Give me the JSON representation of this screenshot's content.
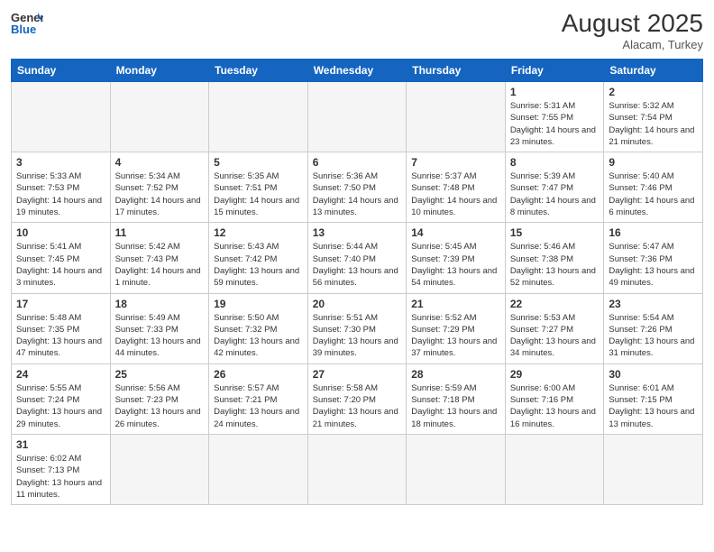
{
  "header": {
    "logo_general": "General",
    "logo_blue": "Blue",
    "month_year": "August 2025",
    "location": "Alacam, Turkey"
  },
  "weekdays": [
    "Sunday",
    "Monday",
    "Tuesday",
    "Wednesday",
    "Thursday",
    "Friday",
    "Saturday"
  ],
  "weeks": [
    [
      {
        "day": "",
        "info": ""
      },
      {
        "day": "",
        "info": ""
      },
      {
        "day": "",
        "info": ""
      },
      {
        "day": "",
        "info": ""
      },
      {
        "day": "",
        "info": ""
      },
      {
        "day": "1",
        "info": "Sunrise: 5:31 AM\nSunset: 7:55 PM\nDaylight: 14 hours\nand 23 minutes."
      },
      {
        "day": "2",
        "info": "Sunrise: 5:32 AM\nSunset: 7:54 PM\nDaylight: 14 hours\nand 21 minutes."
      }
    ],
    [
      {
        "day": "3",
        "info": "Sunrise: 5:33 AM\nSunset: 7:53 PM\nDaylight: 14 hours\nand 19 minutes."
      },
      {
        "day": "4",
        "info": "Sunrise: 5:34 AM\nSunset: 7:52 PM\nDaylight: 14 hours\nand 17 minutes."
      },
      {
        "day": "5",
        "info": "Sunrise: 5:35 AM\nSunset: 7:51 PM\nDaylight: 14 hours\nand 15 minutes."
      },
      {
        "day": "6",
        "info": "Sunrise: 5:36 AM\nSunset: 7:50 PM\nDaylight: 14 hours\nand 13 minutes."
      },
      {
        "day": "7",
        "info": "Sunrise: 5:37 AM\nSunset: 7:48 PM\nDaylight: 14 hours\nand 10 minutes."
      },
      {
        "day": "8",
        "info": "Sunrise: 5:39 AM\nSunset: 7:47 PM\nDaylight: 14 hours\nand 8 minutes."
      },
      {
        "day": "9",
        "info": "Sunrise: 5:40 AM\nSunset: 7:46 PM\nDaylight: 14 hours\nand 6 minutes."
      }
    ],
    [
      {
        "day": "10",
        "info": "Sunrise: 5:41 AM\nSunset: 7:45 PM\nDaylight: 14 hours\nand 3 minutes."
      },
      {
        "day": "11",
        "info": "Sunrise: 5:42 AM\nSunset: 7:43 PM\nDaylight: 14 hours\nand 1 minute."
      },
      {
        "day": "12",
        "info": "Sunrise: 5:43 AM\nSunset: 7:42 PM\nDaylight: 13 hours\nand 59 minutes."
      },
      {
        "day": "13",
        "info": "Sunrise: 5:44 AM\nSunset: 7:40 PM\nDaylight: 13 hours\nand 56 minutes."
      },
      {
        "day": "14",
        "info": "Sunrise: 5:45 AM\nSunset: 7:39 PM\nDaylight: 13 hours\nand 54 minutes."
      },
      {
        "day": "15",
        "info": "Sunrise: 5:46 AM\nSunset: 7:38 PM\nDaylight: 13 hours\nand 52 minutes."
      },
      {
        "day": "16",
        "info": "Sunrise: 5:47 AM\nSunset: 7:36 PM\nDaylight: 13 hours\nand 49 minutes."
      }
    ],
    [
      {
        "day": "17",
        "info": "Sunrise: 5:48 AM\nSunset: 7:35 PM\nDaylight: 13 hours\nand 47 minutes."
      },
      {
        "day": "18",
        "info": "Sunrise: 5:49 AM\nSunset: 7:33 PM\nDaylight: 13 hours\nand 44 minutes."
      },
      {
        "day": "19",
        "info": "Sunrise: 5:50 AM\nSunset: 7:32 PM\nDaylight: 13 hours\nand 42 minutes."
      },
      {
        "day": "20",
        "info": "Sunrise: 5:51 AM\nSunset: 7:30 PM\nDaylight: 13 hours\nand 39 minutes."
      },
      {
        "day": "21",
        "info": "Sunrise: 5:52 AM\nSunset: 7:29 PM\nDaylight: 13 hours\nand 37 minutes."
      },
      {
        "day": "22",
        "info": "Sunrise: 5:53 AM\nSunset: 7:27 PM\nDaylight: 13 hours\nand 34 minutes."
      },
      {
        "day": "23",
        "info": "Sunrise: 5:54 AM\nSunset: 7:26 PM\nDaylight: 13 hours\nand 31 minutes."
      }
    ],
    [
      {
        "day": "24",
        "info": "Sunrise: 5:55 AM\nSunset: 7:24 PM\nDaylight: 13 hours\nand 29 minutes."
      },
      {
        "day": "25",
        "info": "Sunrise: 5:56 AM\nSunset: 7:23 PM\nDaylight: 13 hours\nand 26 minutes."
      },
      {
        "day": "26",
        "info": "Sunrise: 5:57 AM\nSunset: 7:21 PM\nDaylight: 13 hours\nand 24 minutes."
      },
      {
        "day": "27",
        "info": "Sunrise: 5:58 AM\nSunset: 7:20 PM\nDaylight: 13 hours\nand 21 minutes."
      },
      {
        "day": "28",
        "info": "Sunrise: 5:59 AM\nSunset: 7:18 PM\nDaylight: 13 hours\nand 18 minutes."
      },
      {
        "day": "29",
        "info": "Sunrise: 6:00 AM\nSunset: 7:16 PM\nDaylight: 13 hours\nand 16 minutes."
      },
      {
        "day": "30",
        "info": "Sunrise: 6:01 AM\nSunset: 7:15 PM\nDaylight: 13 hours\nand 13 minutes."
      }
    ],
    [
      {
        "day": "31",
        "info": "Sunrise: 6:02 AM\nSunset: 7:13 PM\nDaylight: 13 hours\nand 11 minutes."
      },
      {
        "day": "",
        "info": ""
      },
      {
        "day": "",
        "info": ""
      },
      {
        "day": "",
        "info": ""
      },
      {
        "day": "",
        "info": ""
      },
      {
        "day": "",
        "info": ""
      },
      {
        "day": "",
        "info": ""
      }
    ]
  ]
}
